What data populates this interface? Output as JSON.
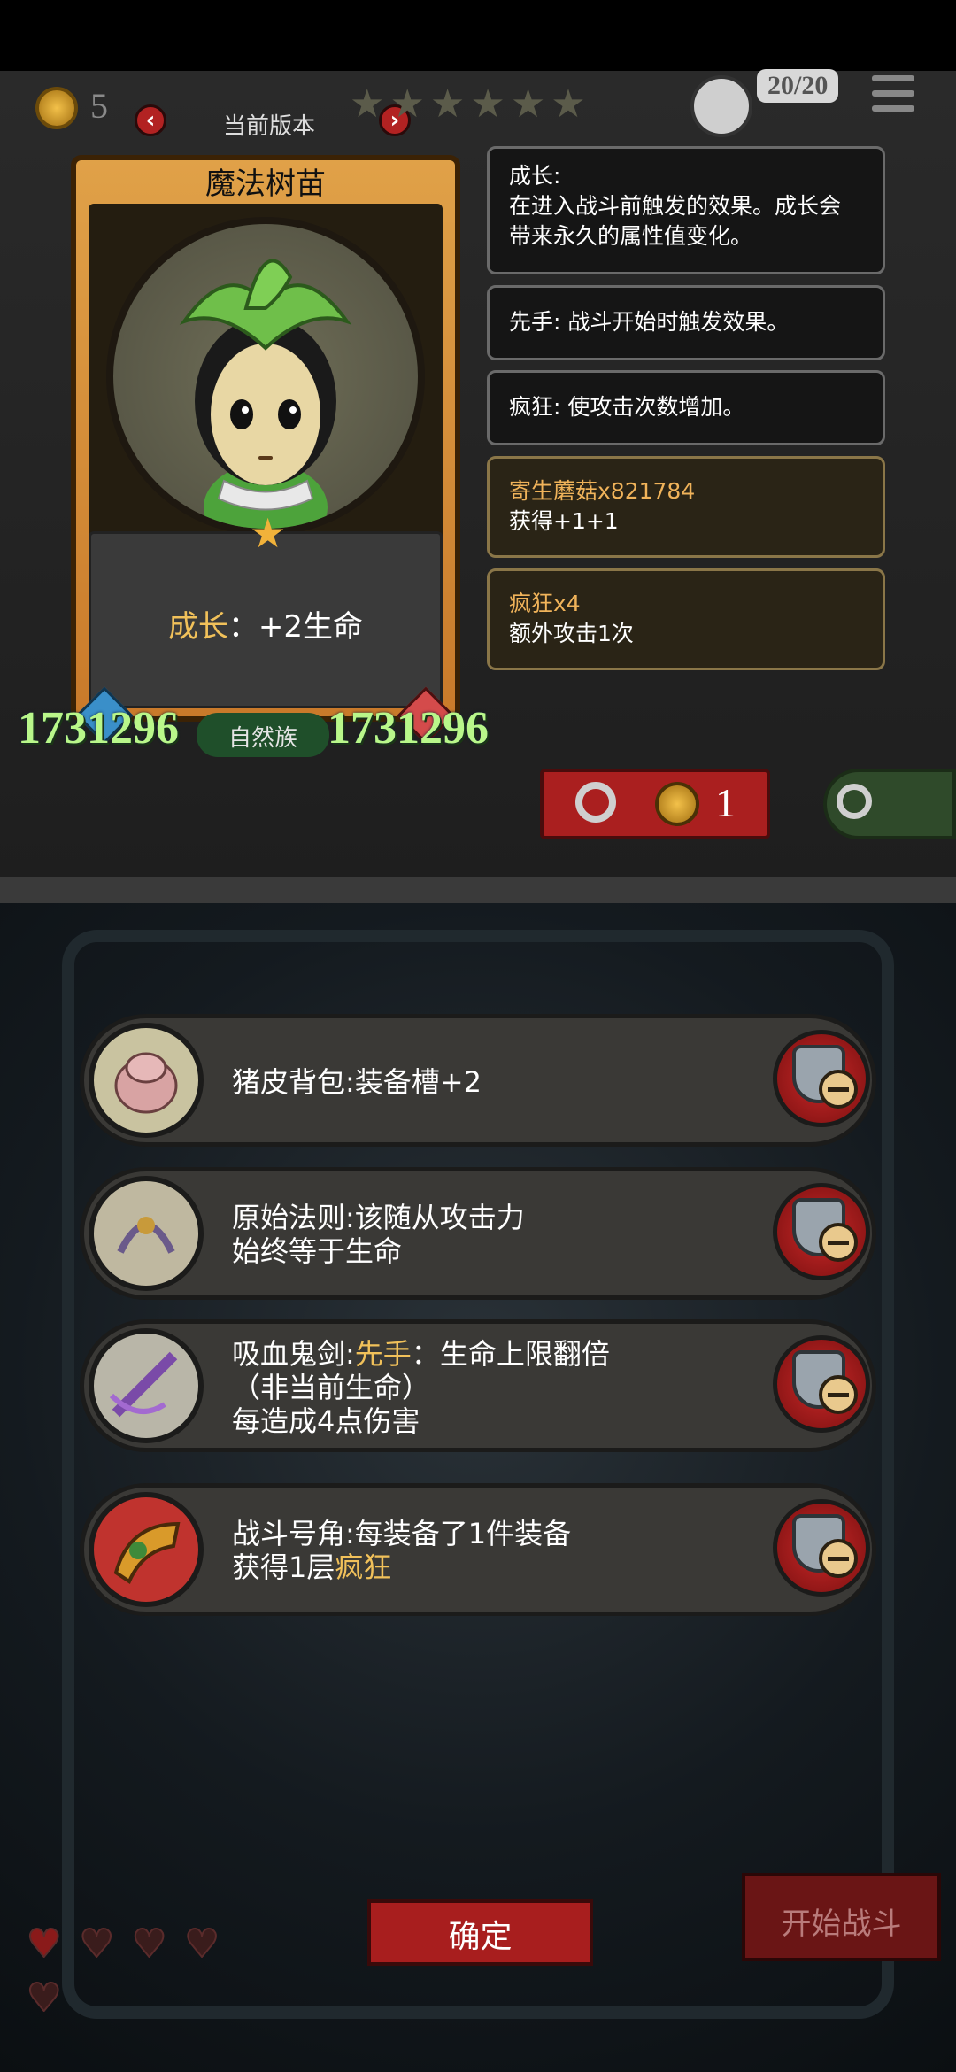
{
  "topbar": {
    "coins": "5",
    "version_label": "当前版本",
    "prev_arrow": "‹",
    "next_arrow": "›",
    "stars": [
      "★",
      "★",
      "★",
      "★",
      "★",
      "★",
      "★"
    ],
    "capacity": "20/20"
  },
  "card": {
    "name": "魔法树苗",
    "desc_keyword": "成长",
    "desc_rest": "：+2生命",
    "attack": "1731296",
    "health": "1731296",
    "tribe": "自然族",
    "star": "★"
  },
  "tooltips": [
    {
      "line1": "成长:",
      "line2": "在进入战斗前触发的效果。成长会",
      "line3": "带来永久的属性值变化。"
    },
    {
      "line1": "先手: 战斗开始时触发效果。"
    },
    {
      "line1": "疯狂: 使攻击次数增加。"
    },
    {
      "line1": "寄生蘑菇x821784",
      "line2": "获得+1+1"
    },
    {
      "line1": "疯狂x4",
      "line2": "额外攻击1次"
    }
  ],
  "refresh": {
    "cost": "1"
  },
  "equipment": [
    {
      "line1": "猪皮背包:装备槽+2"
    },
    {
      "line1": "原始法则:该随从攻击力",
      "line2": "始终等于生命"
    },
    {
      "line1_pre": "吸血鬼剑:",
      "line1_kw": "先手",
      "line1_post": "：生命上限翻倍",
      "line2": "（非当前生命）",
      "line3": "每造成4点伤害"
    },
    {
      "line1": "战斗号角:每装备了1件装备",
      "line2_pre": "获得1层",
      "line2_kw": "疯狂"
    }
  ],
  "buttons": {
    "confirm": "确定",
    "start_battle": "开始战斗"
  },
  "hearts": [
    "♥",
    "♥",
    "♥",
    "♥",
    "♥"
  ],
  "colors": {
    "keyword": "#f1c15a",
    "stat_green": "#b9f78a",
    "button_red": "#a81e1e"
  }
}
